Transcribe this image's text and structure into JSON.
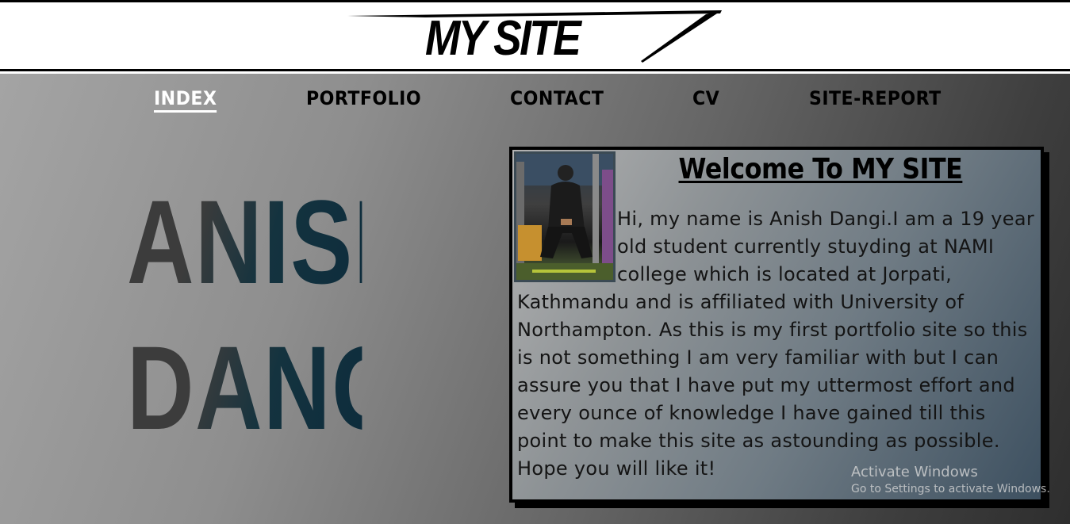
{
  "header": {
    "logo_text": "MY SITE"
  },
  "nav": {
    "items": [
      {
        "label": "INDEX",
        "active": true
      },
      {
        "label": "PORTFOLIO"
      },
      {
        "label": "CONTACT"
      },
      {
        "label": "CV"
      },
      {
        "label": "SITE-REPORT"
      }
    ]
  },
  "hero": {
    "name_line1": "ANISH",
    "name_line2": "DANGI"
  },
  "welcome": {
    "title": "Welcome To MY SITE",
    "body": "Hi, my name is Anish Dangi.I am a 19 year old student currently stuyding at NAMI college which is located at Jorpati, Kathmandu and is affiliated with University of Northampton. As this is my first portfolio site so this is not something I am very familiar with but I can assure you that I have put my uttermost effort and every ounce of knowledge I have gained till this point to make this site as astounding as possible. Hope you will like it!"
  },
  "os_watermark": {
    "line1": "Activate Windows",
    "line2": "Go to Settings to activate Windows."
  }
}
